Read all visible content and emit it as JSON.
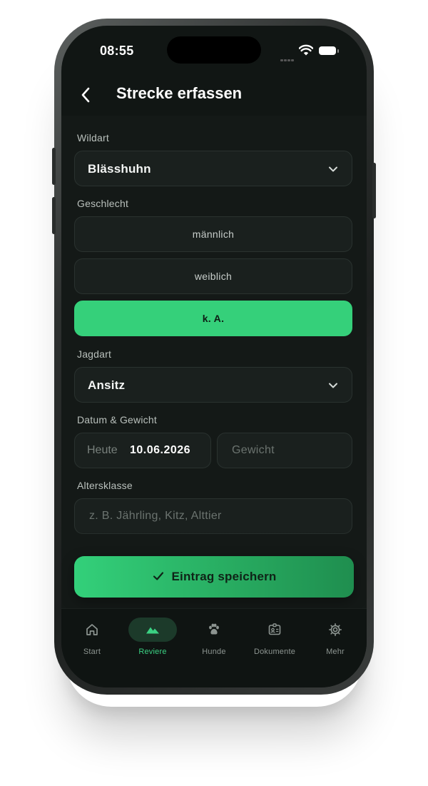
{
  "status_bar": {
    "time": "08:55"
  },
  "header": {
    "back_icon": "chevron-left-icon",
    "title": "Strecke erfassen"
  },
  "form": {
    "wildart": {
      "label": "Wildart",
      "value": "Blässhuhn"
    },
    "geschlecht": {
      "label": "Geschlecht",
      "options": [
        "männlich",
        "weiblich",
        "k. A."
      ],
      "selected": "k. A."
    },
    "jagdart": {
      "label": "Jagdart",
      "value": "Ansitz"
    },
    "datum_gewicht": {
      "label": "Datum & Gewicht",
      "date_prefix": "Heute",
      "date_value": "10.06.2026",
      "weight_placeholder": "Gewicht"
    },
    "altersklasse": {
      "label": "Altersklasse",
      "placeholder": "z. B. Jährling, Kitz, Alttier"
    }
  },
  "save_button": {
    "label": "Eintrag speichern",
    "icon": "check-icon"
  },
  "tab_bar": {
    "items": [
      {
        "label": "Start",
        "icon": "home-icon",
        "active": false
      },
      {
        "label": "Reviere",
        "icon": "mountain-icon",
        "active": true
      },
      {
        "label": "Hunde",
        "icon": "paw-icon",
        "active": false
      },
      {
        "label": "Dokumente",
        "icon": "id-card-icon",
        "active": false
      },
      {
        "label": "Mehr",
        "icon": "gear-icon",
        "active": false
      }
    ]
  },
  "colors": {
    "accent": "#35d07a",
    "background": "#111614",
    "field": "#1a201e"
  }
}
